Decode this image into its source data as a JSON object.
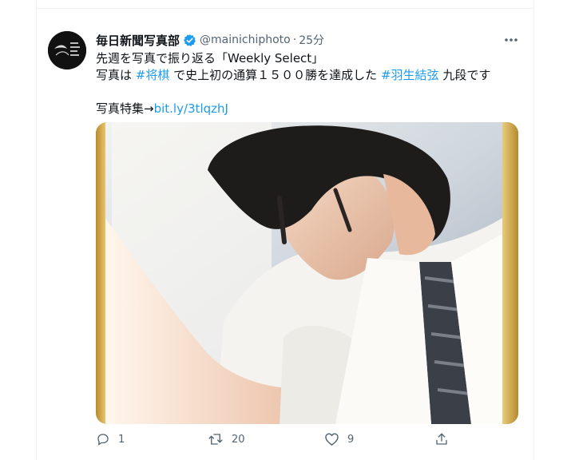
{
  "tweet": {
    "author": {
      "display_name": "毎日新聞写真部",
      "handle": "@mainichiphoto",
      "separator": "·",
      "time": "25分",
      "avatar_icon": "avatar-logo",
      "verified_icon": "verified-badge-icon"
    },
    "text": {
      "line1": "先週を写真で振り返る「Weekly Select」",
      "line2_prefix": "写真は",
      "hashtag1": "#将棋",
      "line2_middle": "で史上初の通算１５００勝を達成した",
      "hashtag2": "#羽生結弦",
      "line2_suffix": "九段です",
      "line3_prefix": "写真特集→",
      "link": "bit.ly/3tlqzhJ"
    },
    "actions": {
      "reply_count": "1",
      "retweet_count": "20",
      "like_count": "9",
      "reply_icon": "reply-icon",
      "retweet_icon": "retweet-icon",
      "like_icon": "heart-icon",
      "share_icon": "share-icon"
    },
    "more_icon": "more-options-icon",
    "colors": {
      "link": "#1d9bf0",
      "secondary_text": "#536471",
      "primary_text": "#0f1419"
    }
  }
}
